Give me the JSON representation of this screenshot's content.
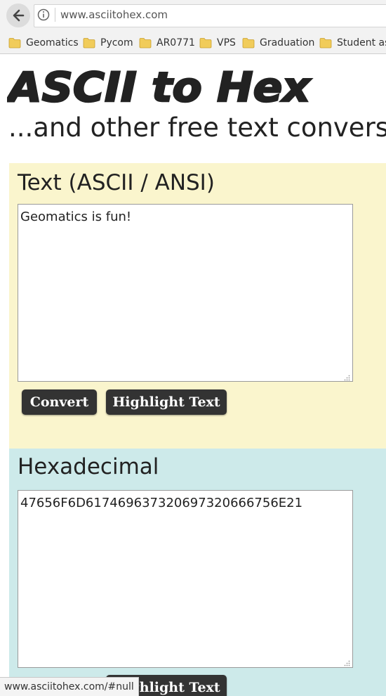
{
  "browser": {
    "url": "www.asciitohex.com",
    "icons": {
      "back": "arrow-left-icon",
      "site_info": "info-circle-icon",
      "bookmark": "folder-icon"
    },
    "bookmarks": [
      {
        "label": "Geomatics"
      },
      {
        "label": "Pycom"
      },
      {
        "label": "AR0771"
      },
      {
        "label": "VPS"
      },
      {
        "label": "Graduation"
      },
      {
        "label": "Student as"
      }
    ],
    "status_url": "www.asciitohex.com/#null"
  },
  "site": {
    "logo_text": "ASCII to Hex",
    "tagline": "...and other free text convers"
  },
  "ascii_panel": {
    "heading": "Text (ASCII / ANSI)",
    "value": "Geomatics is fun!",
    "convert_label": "Convert",
    "highlight_label": "Highlight Text",
    "background": "#faf5cd"
  },
  "hex_panel": {
    "heading": "Hexadecimal",
    "value": "47656F6D617469637320697320666756E21",
    "highlight_label": "Highlight Text",
    "background": "#cdeaea"
  },
  "colors": {
    "button": "#333333",
    "button_text": "#ffffff",
    "text": "#222222"
  }
}
